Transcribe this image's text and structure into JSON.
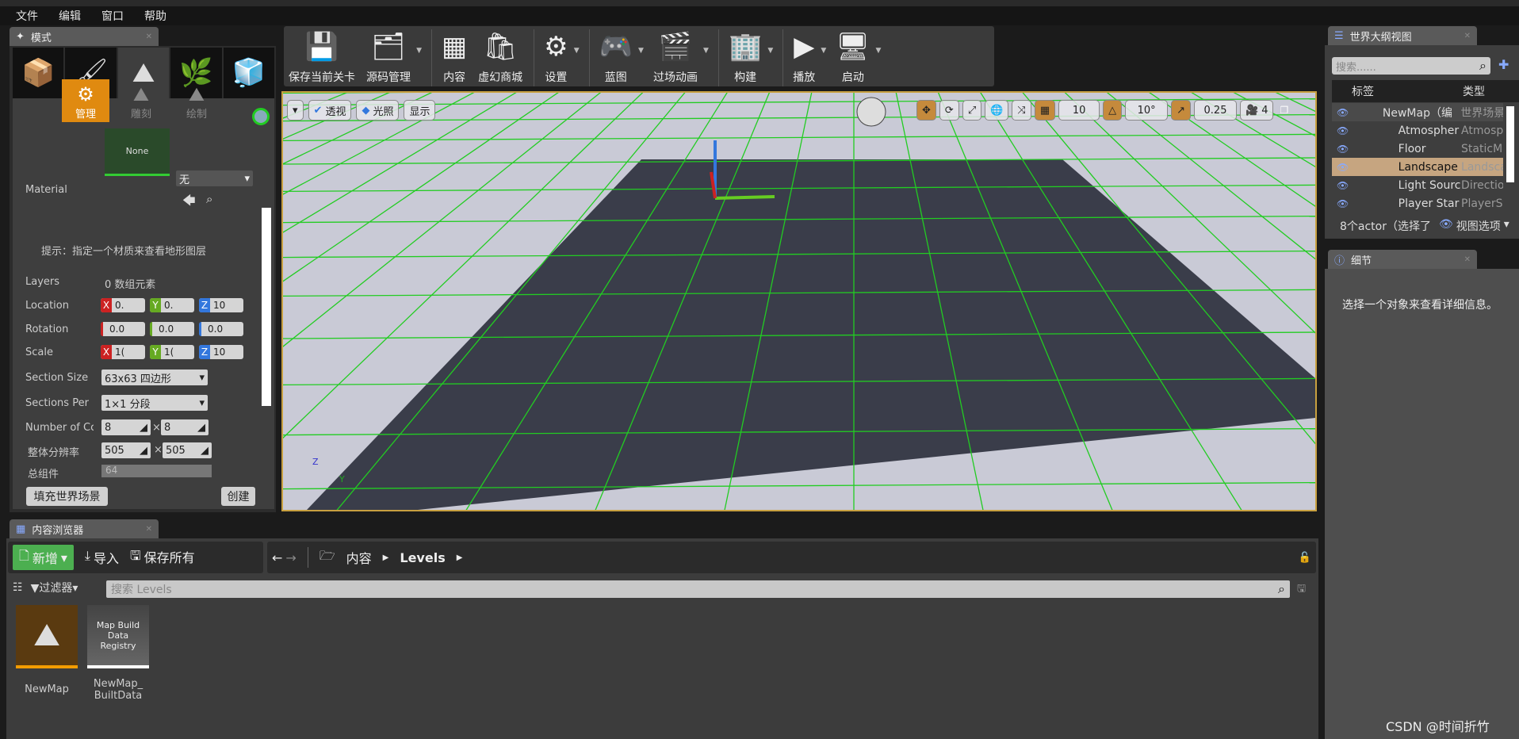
{
  "menu": [
    "文件",
    "编辑",
    "窗口",
    "帮助"
  ],
  "modes": {
    "tab": "模式",
    "tools": [
      "manage",
      "sculpt",
      "paint"
    ],
    "tool_labels": [
      "管理",
      "雕刻",
      "绘制"
    ],
    "material_label": "Material",
    "material_thumb": "None",
    "material_combo": "无",
    "hint": "提示：指定一个材质来查看地形图层",
    "layers_label": "Layers",
    "layers_value": "0 数组元素",
    "location_label": "Location",
    "location": [
      "0.",
      "0.",
      "10"
    ],
    "rotation_label": "Rotation",
    "rotation": [
      "0.0",
      "0.0",
      "0.0"
    ],
    "scale_label": "Scale",
    "scale": [
      "1(",
      "1(",
      "10"
    ],
    "section_size_label": "Section Size",
    "section_size": "63x63 四边形",
    "sections_per_label": "Sections Per",
    "sections_per": "1×1 分段",
    "num_components_label": "Number of Cc",
    "num_components": [
      "8",
      "8"
    ],
    "resolution_label": "整体分辨率",
    "resolution": [
      "505",
      "505"
    ],
    "total_label": "总组件",
    "total": "64",
    "fill_button": "填充世界场景",
    "create_button": "创建"
  },
  "toolbar": [
    {
      "label": "保存当前关卡",
      "icon": "💾",
      "dd": false
    },
    {
      "label": "源码管理",
      "icon": "🗂",
      "dd": true
    },
    {
      "label": "内容",
      "icon": "▦",
      "dd": false
    },
    {
      "label": "虚幻商城",
      "icon": "🛍",
      "dd": false
    },
    {
      "label": "设置",
      "icon": "⚙",
      "dd": true
    },
    {
      "label": "蓝图",
      "icon": "🎮",
      "dd": true
    },
    {
      "label": "过场动画",
      "icon": "🎬",
      "dd": true
    },
    {
      "label": "构建",
      "icon": "🏢",
      "dd": true
    },
    {
      "label": "播放",
      "icon": "▶",
      "dd": true
    },
    {
      "label": "启动",
      "icon": "🖥",
      "dd": true
    }
  ],
  "viewport": {
    "perspective": "透视",
    "lighting": "光照",
    "show": "显示",
    "grid_snap": "10",
    "rot_snap": "10°",
    "scale_snap": "0.25",
    "cam_speed": "4",
    "axis_z": "Z",
    "axis_y": "Y"
  },
  "outliner": {
    "tab": "世界大纲视图",
    "search_placeholder": "搜索......",
    "col_label": "标签",
    "col_type": "类型",
    "rows": [
      {
        "name": "NewMap（编",
        "type": "世界场景"
      },
      {
        "name": "Atmospher",
        "type": "Atmospl"
      },
      {
        "name": "Floor",
        "type": "StaticMe"
      },
      {
        "name": "Landscape",
        "type": "Landsca",
        "selected": true
      },
      {
        "name": "Light Sourc",
        "type": "Directior"
      },
      {
        "name": "Player Star",
        "type": "PlayerSt"
      }
    ],
    "footer": "8个actor（选择了",
    "view_options": "视图选项"
  },
  "details": {
    "tab": "细节",
    "empty": "选择一个对象来查看详细信息。"
  },
  "content": {
    "tab": "内容浏览器",
    "new": "新增",
    "import": "导入",
    "save_all": "保存所有",
    "path": [
      "内容",
      "Levels"
    ],
    "filter": "过滤器",
    "search_placeholder": "搜索 Levels",
    "assets": [
      {
        "name": "NewMap"
      },
      {
        "name": "NewMap_\nBuiltData",
        "thumb": "Map Build Data Registry"
      }
    ]
  },
  "watermark": "CSDN @时间折竹",
  "colors": {
    "accent": "#e08a10",
    "new_button": "#4caf50",
    "selected_row": "#c6a580"
  }
}
